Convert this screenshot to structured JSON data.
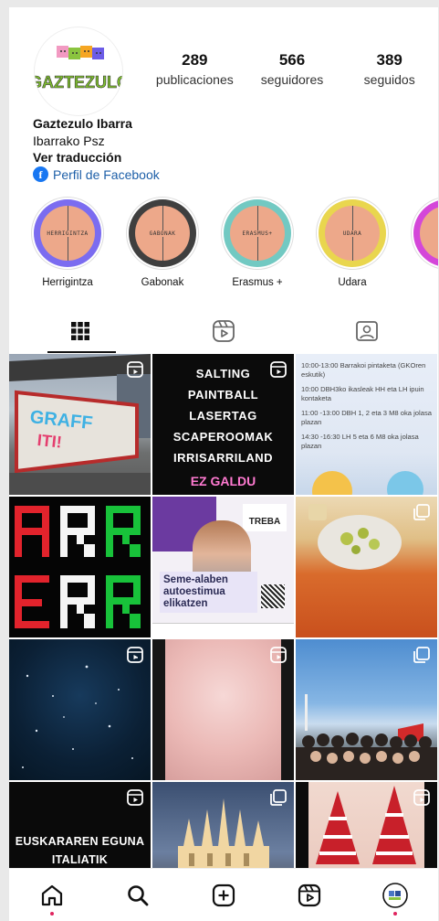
{
  "profile": {
    "avatar_text": "GAZTEZULO",
    "display_name": "Gaztezulo Ibarra",
    "category": "Ibarrako Psz",
    "translate": "Ver traducción",
    "facebook": "Perfil de Facebook"
  },
  "stats": [
    {
      "num": "289",
      "label": "publicaciones"
    },
    {
      "num": "566",
      "label": "seguidores"
    },
    {
      "num": "389",
      "label": "seguidos"
    }
  ],
  "highlights": [
    {
      "label": "Herrigintza",
      "inner": "HERRIGINTZA",
      "ring": "#7b6cf0"
    },
    {
      "label": "Gabonak",
      "inner": "GABONAK",
      "ring": "#3f3f3f"
    },
    {
      "label": "Erasmus +",
      "inner": "ERASMUS+",
      "ring": "#72c9c2"
    },
    {
      "label": "Udara",
      "inner": "UDARA",
      "ring": "#e9d64e"
    },
    {
      "label": "",
      "inner": "",
      "ring": "#d447d9"
    }
  ],
  "posts": {
    "p2_lines": [
      "SALTING",
      "PAINTBALL",
      "LASERTAG",
      "SCAPEROOMAK",
      "IRRISARRILAND"
    ],
    "p2_footer": "EZ GALDU",
    "p3_lines": [
      "10:00-13:00 Barrakoi pintaketa (GKOren eskutik)",
      "10:00 DBH3ko ikasleak HH eta LH ipuin kontaketa",
      "11:00 -13:00 DBH 1, 2 eta 3 M8 oka jolasa plazan",
      "14:30 -16:30 LH 5 eta 6 M8 oka jolasa plazan"
    ],
    "p4_rows": [
      "ARR",
      "ERR"
    ],
    "p5_brand": "TREBA",
    "p5_title": "Seme-alaben autoestimua elikatzen",
    "p10_line1": "EUSKARAREN EGUNA",
    "p10_line2": "ITALIATIK"
  },
  "colors": {
    "accent_link": "#1d5fa8",
    "notification_dot": "#e0245e"
  }
}
